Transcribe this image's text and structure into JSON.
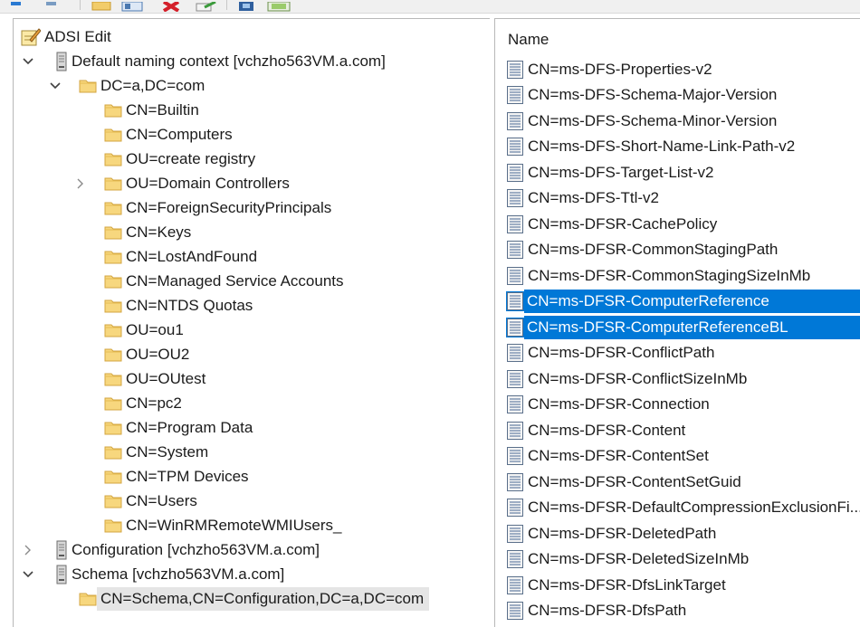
{
  "toolbar": {
    "buttons": [
      "back-icon",
      "forward-icon",
      "folder-icon",
      "show-hide-tree-icon",
      "delete-icon",
      "export-icon",
      "properties-icon",
      "help-icon"
    ]
  },
  "tree": {
    "root_label": "ADSI Edit",
    "items": [
      {
        "label": "Default naming context [vchzho563VM.a.com]",
        "icon": "server-icon",
        "level": 1,
        "expanded": true
      },
      {
        "label": "DC=a,DC=com",
        "icon": "folder-icon",
        "level": 2,
        "expanded": true
      },
      {
        "label": "CN=Builtin",
        "icon": "folder-icon",
        "level": 3
      },
      {
        "label": "CN=Computers",
        "icon": "folder-icon",
        "level": 3
      },
      {
        "label": "OU=create registry",
        "icon": "folder-icon",
        "level": 3
      },
      {
        "label": "OU=Domain Controllers",
        "icon": "folder-icon",
        "level": 3,
        "expanded": false
      },
      {
        "label": "CN=ForeignSecurityPrincipals",
        "icon": "folder-icon",
        "level": 3
      },
      {
        "label": "CN=Keys",
        "icon": "folder-icon",
        "level": 3
      },
      {
        "label": "CN=LostAndFound",
        "icon": "folder-icon",
        "level": 3
      },
      {
        "label": "CN=Managed Service Accounts",
        "icon": "folder-icon",
        "level": 3
      },
      {
        "label": "CN=NTDS Quotas",
        "icon": "folder-icon",
        "level": 3
      },
      {
        "label": "OU=ou1",
        "icon": "folder-icon",
        "level": 3
      },
      {
        "label": "OU=OU2",
        "icon": "folder-icon",
        "level": 3
      },
      {
        "label": "OU=OUtest",
        "icon": "folder-icon",
        "level": 3
      },
      {
        "label": "CN=pc2",
        "icon": "folder-icon",
        "level": 3
      },
      {
        "label": "CN=Program Data",
        "icon": "folder-icon",
        "level": 3
      },
      {
        "label": "CN=System",
        "icon": "folder-icon",
        "level": 3
      },
      {
        "label": "CN=TPM Devices",
        "icon": "folder-icon",
        "level": 3
      },
      {
        "label": "CN=Users",
        "icon": "folder-icon",
        "level": 3
      },
      {
        "label": "CN=WinRMRemoteWMIUsers_",
        "icon": "folder-icon",
        "level": 3
      },
      {
        "label": "Configuration [vchzho563VM.a.com]",
        "icon": "server-icon",
        "level": 1,
        "expanded": false
      },
      {
        "label": "Schema [vchzho563VM.a.com]",
        "icon": "server-icon",
        "level": 1,
        "expanded": true
      },
      {
        "label": "CN=Schema,CN=Configuration,DC=a,DC=com",
        "icon": "folder-icon",
        "level": 2,
        "selected": true
      }
    ]
  },
  "list": {
    "column_header": "Name",
    "items": [
      {
        "label": "CN=ms-DFS-Properties-v2"
      },
      {
        "label": "CN=ms-DFS-Schema-Major-Version"
      },
      {
        "label": "CN=ms-DFS-Schema-Minor-Version"
      },
      {
        "label": "CN=ms-DFS-Short-Name-Link-Path-v2"
      },
      {
        "label": "CN=ms-DFS-Target-List-v2"
      },
      {
        "label": "CN=ms-DFS-Ttl-v2"
      },
      {
        "label": "CN=ms-DFSR-CachePolicy"
      },
      {
        "label": "CN=ms-DFSR-CommonStagingPath"
      },
      {
        "label": "CN=ms-DFSR-CommonStagingSizeInMb"
      },
      {
        "label": "CN=ms-DFSR-ComputerReference",
        "selected": true
      },
      {
        "label": "CN=ms-DFSR-ComputerReferenceBL",
        "selected": true
      },
      {
        "label": "CN=ms-DFSR-ConflictPath"
      },
      {
        "label": "CN=ms-DFSR-ConflictSizeInMb"
      },
      {
        "label": "CN=ms-DFSR-Connection"
      },
      {
        "label": "CN=ms-DFSR-Content"
      },
      {
        "label": "CN=ms-DFSR-ContentSet"
      },
      {
        "label": "CN=ms-DFSR-ContentSetGuid"
      },
      {
        "label": "CN=ms-DFSR-DefaultCompressionExclusionFi..."
      },
      {
        "label": "CN=ms-DFSR-DeletedPath"
      },
      {
        "label": "CN=ms-DFSR-DeletedSizeInMb"
      },
      {
        "label": "CN=ms-DFSR-DfsLinkTarget"
      },
      {
        "label": "CN=ms-DFSR-DfsPath"
      }
    ]
  },
  "colors": {
    "selection": "#0078d7",
    "tree_selection": "#e5e5e5",
    "folder": "#f2cc6a"
  }
}
